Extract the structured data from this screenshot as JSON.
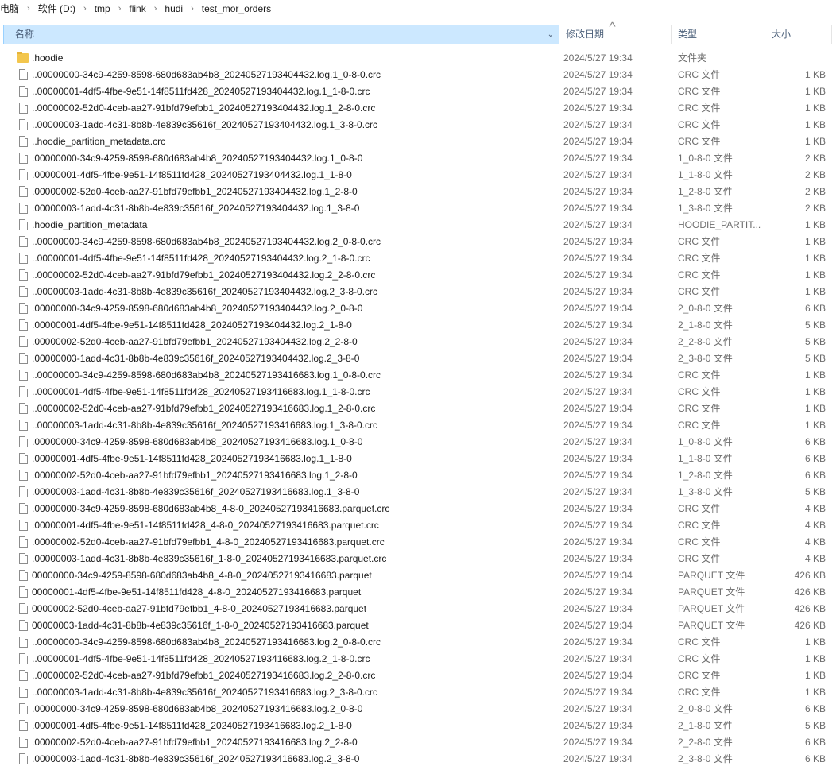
{
  "breadcrumb": [
    "电脑",
    "软件 (D:)",
    "tmp",
    "flink",
    "hudi",
    "test_mor_orders"
  ],
  "columns": {
    "name": "名称",
    "date": "修改日期",
    "type": "类型",
    "size": "大小"
  },
  "files": [
    {
      "icon": "folder",
      "name": ".hoodie",
      "date": "2024/5/27 19:34",
      "type": "文件夹",
      "size": ""
    },
    {
      "icon": "file",
      "name": "..00000000-34c9-4259-8598-680d683ab4b8_20240527193404432.log.1_0-8-0.crc",
      "date": "2024/5/27 19:34",
      "type": "CRC 文件",
      "size": "1 KB"
    },
    {
      "icon": "file",
      "name": "..00000001-4df5-4fbe-9e51-14f8511fd428_20240527193404432.log.1_1-8-0.crc",
      "date": "2024/5/27 19:34",
      "type": "CRC 文件",
      "size": "1 KB"
    },
    {
      "icon": "file",
      "name": "..00000002-52d0-4ceb-aa27-91bfd79efbb1_20240527193404432.log.1_2-8-0.crc",
      "date": "2024/5/27 19:34",
      "type": "CRC 文件",
      "size": "1 KB"
    },
    {
      "icon": "file",
      "name": "..00000003-1add-4c31-8b8b-4e839c35616f_20240527193404432.log.1_3-8-0.crc",
      "date": "2024/5/27 19:34",
      "type": "CRC 文件",
      "size": "1 KB"
    },
    {
      "icon": "file",
      "name": "..hoodie_partition_metadata.crc",
      "date": "2024/5/27 19:34",
      "type": "CRC 文件",
      "size": "1 KB"
    },
    {
      "icon": "file",
      "name": ".00000000-34c9-4259-8598-680d683ab4b8_20240527193404432.log.1_0-8-0",
      "date": "2024/5/27 19:34",
      "type": "1_0-8-0 文件",
      "size": "2 KB"
    },
    {
      "icon": "file",
      "name": ".00000001-4df5-4fbe-9e51-14f8511fd428_20240527193404432.log.1_1-8-0",
      "date": "2024/5/27 19:34",
      "type": "1_1-8-0 文件",
      "size": "2 KB"
    },
    {
      "icon": "file",
      "name": ".00000002-52d0-4ceb-aa27-91bfd79efbb1_20240527193404432.log.1_2-8-0",
      "date": "2024/5/27 19:34",
      "type": "1_2-8-0 文件",
      "size": "2 KB"
    },
    {
      "icon": "file",
      "name": ".00000003-1add-4c31-8b8b-4e839c35616f_20240527193404432.log.1_3-8-0",
      "date": "2024/5/27 19:34",
      "type": "1_3-8-0 文件",
      "size": "2 KB"
    },
    {
      "icon": "file",
      "name": ".hoodie_partition_metadata",
      "date": "2024/5/27 19:34",
      "type": "HOODIE_PARTIT...",
      "size": "1 KB"
    },
    {
      "icon": "file",
      "name": "..00000000-34c9-4259-8598-680d683ab4b8_20240527193404432.log.2_0-8-0.crc",
      "date": "2024/5/27 19:34",
      "type": "CRC 文件",
      "size": "1 KB"
    },
    {
      "icon": "file",
      "name": "..00000001-4df5-4fbe-9e51-14f8511fd428_20240527193404432.log.2_1-8-0.crc",
      "date": "2024/5/27 19:34",
      "type": "CRC 文件",
      "size": "1 KB"
    },
    {
      "icon": "file",
      "name": "..00000002-52d0-4ceb-aa27-91bfd79efbb1_20240527193404432.log.2_2-8-0.crc",
      "date": "2024/5/27 19:34",
      "type": "CRC 文件",
      "size": "1 KB"
    },
    {
      "icon": "file",
      "name": "..00000003-1add-4c31-8b8b-4e839c35616f_20240527193404432.log.2_3-8-0.crc",
      "date": "2024/5/27 19:34",
      "type": "CRC 文件",
      "size": "1 KB"
    },
    {
      "icon": "file",
      "name": ".00000000-34c9-4259-8598-680d683ab4b8_20240527193404432.log.2_0-8-0",
      "date": "2024/5/27 19:34",
      "type": "2_0-8-0 文件",
      "size": "6 KB"
    },
    {
      "icon": "file",
      "name": ".00000001-4df5-4fbe-9e51-14f8511fd428_20240527193404432.log.2_1-8-0",
      "date": "2024/5/27 19:34",
      "type": "2_1-8-0 文件",
      "size": "5 KB"
    },
    {
      "icon": "file",
      "name": ".00000002-52d0-4ceb-aa27-91bfd79efbb1_20240527193404432.log.2_2-8-0",
      "date": "2024/5/27 19:34",
      "type": "2_2-8-0 文件",
      "size": "5 KB"
    },
    {
      "icon": "file",
      "name": ".00000003-1add-4c31-8b8b-4e839c35616f_20240527193404432.log.2_3-8-0",
      "date": "2024/5/27 19:34",
      "type": "2_3-8-0 文件",
      "size": "5 KB"
    },
    {
      "icon": "file",
      "name": "..00000000-34c9-4259-8598-680d683ab4b8_20240527193416683.log.1_0-8-0.crc",
      "date": "2024/5/27 19:34",
      "type": "CRC 文件",
      "size": "1 KB"
    },
    {
      "icon": "file",
      "name": "..00000001-4df5-4fbe-9e51-14f8511fd428_20240527193416683.log.1_1-8-0.crc",
      "date": "2024/5/27 19:34",
      "type": "CRC 文件",
      "size": "1 KB"
    },
    {
      "icon": "file",
      "name": "..00000002-52d0-4ceb-aa27-91bfd79efbb1_20240527193416683.log.1_2-8-0.crc",
      "date": "2024/5/27 19:34",
      "type": "CRC 文件",
      "size": "1 KB"
    },
    {
      "icon": "file",
      "name": "..00000003-1add-4c31-8b8b-4e839c35616f_20240527193416683.log.1_3-8-0.crc",
      "date": "2024/5/27 19:34",
      "type": "CRC 文件",
      "size": "1 KB"
    },
    {
      "icon": "file",
      "name": ".00000000-34c9-4259-8598-680d683ab4b8_20240527193416683.log.1_0-8-0",
      "date": "2024/5/27 19:34",
      "type": "1_0-8-0 文件",
      "size": "6 KB"
    },
    {
      "icon": "file",
      "name": ".00000001-4df5-4fbe-9e51-14f8511fd428_20240527193416683.log.1_1-8-0",
      "date": "2024/5/27 19:34",
      "type": "1_1-8-0 文件",
      "size": "6 KB"
    },
    {
      "icon": "file",
      "name": ".00000002-52d0-4ceb-aa27-91bfd79efbb1_20240527193416683.log.1_2-8-0",
      "date": "2024/5/27 19:34",
      "type": "1_2-8-0 文件",
      "size": "6 KB"
    },
    {
      "icon": "file",
      "name": ".00000003-1add-4c31-8b8b-4e839c35616f_20240527193416683.log.1_3-8-0",
      "date": "2024/5/27 19:34",
      "type": "1_3-8-0 文件",
      "size": "5 KB"
    },
    {
      "icon": "file",
      "name": ".00000000-34c9-4259-8598-680d683ab4b8_4-8-0_20240527193416683.parquet.crc",
      "date": "2024/5/27 19:34",
      "type": "CRC 文件",
      "size": "4 KB"
    },
    {
      "icon": "file",
      "name": ".00000001-4df5-4fbe-9e51-14f8511fd428_4-8-0_20240527193416683.parquet.crc",
      "date": "2024/5/27 19:34",
      "type": "CRC 文件",
      "size": "4 KB"
    },
    {
      "icon": "file",
      "name": ".00000002-52d0-4ceb-aa27-91bfd79efbb1_4-8-0_20240527193416683.parquet.crc",
      "date": "2024/5/27 19:34",
      "type": "CRC 文件",
      "size": "4 KB"
    },
    {
      "icon": "file",
      "name": ".00000003-1add-4c31-8b8b-4e839c35616f_1-8-0_20240527193416683.parquet.crc",
      "date": "2024/5/27 19:34",
      "type": "CRC 文件",
      "size": "4 KB"
    },
    {
      "icon": "file",
      "name": "00000000-34c9-4259-8598-680d683ab4b8_4-8-0_20240527193416683.parquet",
      "date": "2024/5/27 19:34",
      "type": "PARQUET 文件",
      "size": "426 KB"
    },
    {
      "icon": "file",
      "name": "00000001-4df5-4fbe-9e51-14f8511fd428_4-8-0_20240527193416683.parquet",
      "date": "2024/5/27 19:34",
      "type": "PARQUET 文件",
      "size": "426 KB"
    },
    {
      "icon": "file",
      "name": "00000002-52d0-4ceb-aa27-91bfd79efbb1_4-8-0_20240527193416683.parquet",
      "date": "2024/5/27 19:34",
      "type": "PARQUET 文件",
      "size": "426 KB"
    },
    {
      "icon": "file",
      "name": "00000003-1add-4c31-8b8b-4e839c35616f_1-8-0_20240527193416683.parquet",
      "date": "2024/5/27 19:34",
      "type": "PARQUET 文件",
      "size": "426 KB"
    },
    {
      "icon": "file",
      "name": "..00000000-34c9-4259-8598-680d683ab4b8_20240527193416683.log.2_0-8-0.crc",
      "date": "2024/5/27 19:34",
      "type": "CRC 文件",
      "size": "1 KB"
    },
    {
      "icon": "file",
      "name": "..00000001-4df5-4fbe-9e51-14f8511fd428_20240527193416683.log.2_1-8-0.crc",
      "date": "2024/5/27 19:34",
      "type": "CRC 文件",
      "size": "1 KB"
    },
    {
      "icon": "file",
      "name": "..00000002-52d0-4ceb-aa27-91bfd79efbb1_20240527193416683.log.2_2-8-0.crc",
      "date": "2024/5/27 19:34",
      "type": "CRC 文件",
      "size": "1 KB"
    },
    {
      "icon": "file",
      "name": "..00000003-1add-4c31-8b8b-4e839c35616f_20240527193416683.log.2_3-8-0.crc",
      "date": "2024/5/27 19:34",
      "type": "CRC 文件",
      "size": "1 KB"
    },
    {
      "icon": "file",
      "name": ".00000000-34c9-4259-8598-680d683ab4b8_20240527193416683.log.2_0-8-0",
      "date": "2024/5/27 19:34",
      "type": "2_0-8-0 文件",
      "size": "6 KB"
    },
    {
      "icon": "file",
      "name": ".00000001-4df5-4fbe-9e51-14f8511fd428_20240527193416683.log.2_1-8-0",
      "date": "2024/5/27 19:34",
      "type": "2_1-8-0 文件",
      "size": "5 KB"
    },
    {
      "icon": "file",
      "name": ".00000002-52d0-4ceb-aa27-91bfd79efbb1_20240527193416683.log.2_2-8-0",
      "date": "2024/5/27 19:34",
      "type": "2_2-8-0 文件",
      "size": "6 KB"
    },
    {
      "icon": "file",
      "name": ".00000003-1add-4c31-8b8b-4e839c35616f_20240527193416683.log.2_3-8-0",
      "date": "2024/5/27 19:34",
      "type": "2_3-8-0 文件",
      "size": "6 KB"
    }
  ]
}
